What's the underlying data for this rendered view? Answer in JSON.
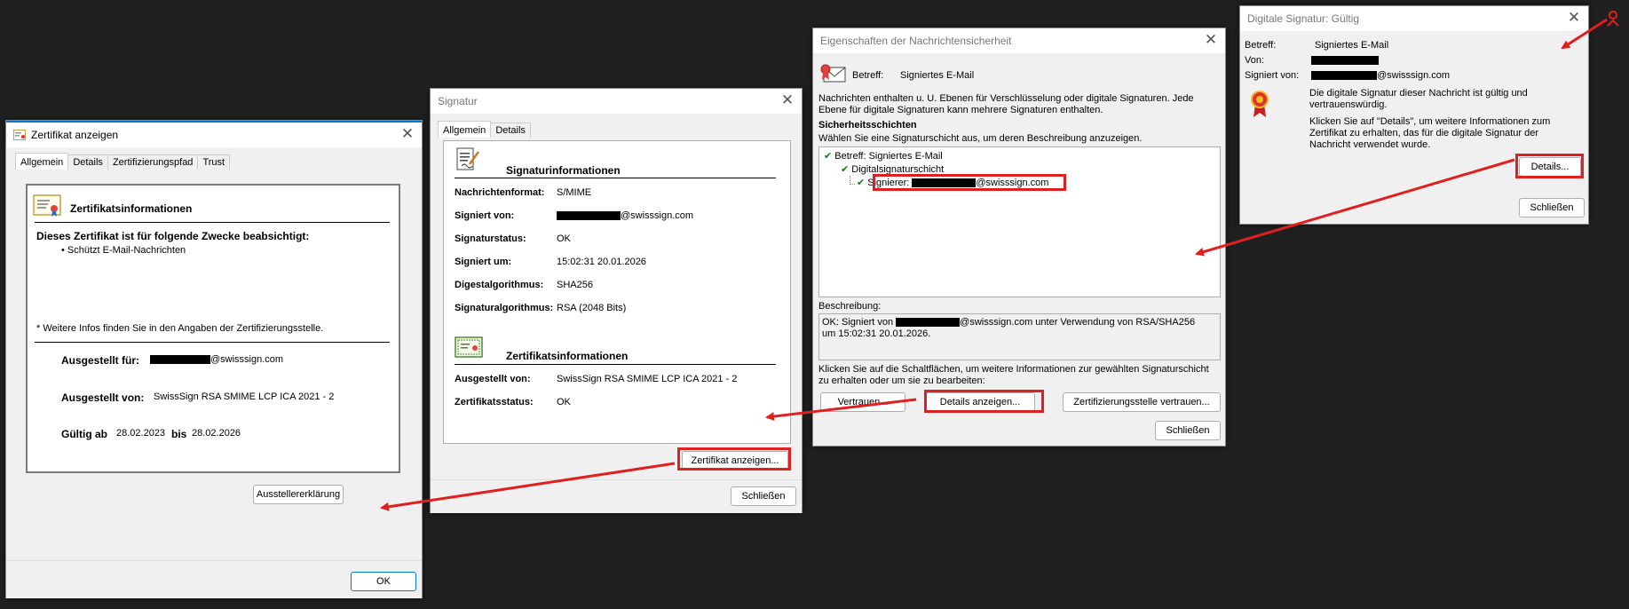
{
  "cert_window": {
    "title": "Zertifikat anzeigen",
    "tabs": [
      "Allgemein",
      "Details",
      "Zertifizierungspfad",
      "Trust"
    ],
    "header": "Zertifikatsinformationen",
    "purpose_title": "Dieses Zertifikat ist für folgende Zwecke beabsichtigt:",
    "purpose_item": "• Schützt E-Mail-Nachrichten",
    "note": "* Weitere Infos finden Sie in den Angaben der Zertifizierungsstelle.",
    "issued_to_label": "Ausgestellt für:",
    "issued_to_value": "@swisssign.com",
    "issued_by_label": "Ausgestellt von:",
    "issued_by_value": "SwissSign RSA SMIME LCP ICA 2021 - 2",
    "valid_label": "Gültig ab",
    "valid_from": "28.02.2023",
    "valid_to_label": "bis",
    "valid_to": "28.02.2026",
    "issuer_statement_button": "Ausstellererklärung",
    "ok_button": "OK"
  },
  "sig_window": {
    "title": "Signatur",
    "tabs": [
      "Allgemein",
      "Details"
    ],
    "sig_header": "Signaturinformationen",
    "rows": [
      {
        "label": "Nachrichtenformat:",
        "value": "S/MIME"
      },
      {
        "label": "Signiert von:",
        "value": "@swisssign.com"
      },
      {
        "label": "Signaturstatus:",
        "value": "OK"
      },
      {
        "label": "Signiert um:",
        "value": "15:02:31 20.01.2026"
      },
      {
        "label": "Digestalgorithmus:",
        "value": "SHA256"
      },
      {
        "label": "Signaturalgorithmus:",
        "value": "RSA (2048 Bits)"
      }
    ],
    "cert_header": "Zertifikatsinformationen",
    "cert_rows": [
      {
        "label": "Ausgestellt von:",
        "value": "SwissSign RSA SMIME LCP ICA 2021 - 2"
      },
      {
        "label": "Zertifikatsstatus:",
        "value": "OK"
      }
    ],
    "view_cert_button": "Zertifikat anzeigen...",
    "close_button": "Schließen"
  },
  "props_window": {
    "title": "Eigenschaften der Nachrichtensicherheit",
    "subject_label": "Betreff:",
    "subject_value": "Signiertes E-Mail",
    "intro": "Nachrichten enthalten u. U. Ebenen für Verschlüsselung oder digitale Signaturen. Jede Ebene für digitale Signaturen kann mehrere Signaturen enthalten.",
    "layers_title": "Sicherheitsschichten",
    "layers_hint": "Wählen Sie eine Signaturschicht aus, um deren Beschreibung anzuzeigen.",
    "tree_item1": "Betreff: Signiertes E-Mail",
    "tree_item2": "Digitalsignaturschicht",
    "tree_item3_label": "Signierer:",
    "tree_item3_value": "@swisssign.com",
    "description_label": "Beschreibung:",
    "description_part1": "OK: Signiert von",
    "description_part2": "@swisssign.com unter Verwendung von RSA/SHA256",
    "description_part3": "um 15:02:31 20.01.2026.",
    "buttons_hint": "Klicken Sie auf die Schaltflächen, um weitere Informationen zur gewählten Signaturschicht zu erhalten oder um sie zu bearbeiten:",
    "trust_button": "Vertrauen...",
    "details_button": "Details anzeigen...",
    "trust_ca_button": "Zertifizierungsstelle vertrauen...",
    "close_button": "Schließen"
  },
  "digsig_window": {
    "title": "Digitale Signatur: Gültig",
    "subject_label": "Betreff:",
    "subject_value": "Signiertes E-Mail",
    "from_label": "Von:",
    "signed_by_label": "Signiert von:",
    "signed_by_value": "@swisssign.com",
    "valid_text": "Die digitale Signatur dieser Nachricht ist gültig und vertrauenswürdig.",
    "info_text": "Klicken Sie auf \"Details\", um weitere Informationen zum Zertifikat zu erhalten, das für die digitale Signatur der Nachricht verwendet wurde.",
    "details_button": "Details...",
    "close_button": "Schließen"
  },
  "colors": {
    "background": "#202020",
    "highlight": "#e0201e",
    "check": "#107c10",
    "accent": "#0078d4"
  }
}
